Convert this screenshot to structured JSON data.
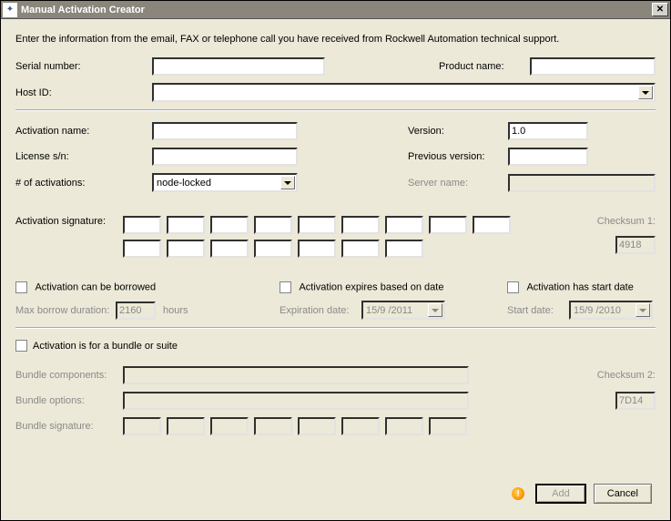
{
  "titlebar": {
    "text": "Manual Activation Creator"
  },
  "instructions": "Enter the information from the email, FAX or telephone call you have received from Rockwell Automation technical support.",
  "top": {
    "serial_label": "Serial number:",
    "serial_value": "",
    "product_label": "Product name:",
    "product_value": "",
    "hostid_label": "Host ID:",
    "hostid_value": ""
  },
  "mid": {
    "activation_name_label": "Activation name:",
    "activation_name_value": "",
    "version_label": "Version:",
    "version_value": "1.0",
    "license_sn_label": "License s/n:",
    "license_sn_value": "",
    "prev_version_label": "Previous version:",
    "prev_version_value": "",
    "num_activations_label": "# of activations:",
    "num_activations_value": "node-locked",
    "server_name_label": "Server name:",
    "server_name_value": ""
  },
  "sig": {
    "label": "Activation signature:",
    "checksum1_label": "Checksum 1:",
    "checksum1_value": "4918",
    "row1": [
      "",
      "",
      "",
      "",
      "",
      "",
      "",
      "",
      ""
    ],
    "row2": [
      "",
      "",
      "",
      "",
      "",
      "",
      ""
    ]
  },
  "checks": {
    "borrow_label": "Activation can be borrowed",
    "expires_label": "Activation expires based on date",
    "startdate_label": "Activation has start date",
    "max_borrow_label": "Max borrow duration:",
    "max_borrow_value": "2160",
    "max_borrow_unit": "hours",
    "expiration_label": "Expiration date:",
    "expiration_value": "15/9 /2011",
    "start_label": "Start date:",
    "start_value": "15/9 /2010"
  },
  "bundle": {
    "suite_label": "Activation is for a bundle or suite",
    "components_label": "Bundle components:",
    "options_label": "Bundle options:",
    "signature_label": "Bundle signature:",
    "checksum2_label": "Checksum 2:",
    "checksum2_value": "7D14"
  },
  "buttons": {
    "add": "Add",
    "cancel": "Cancel"
  }
}
